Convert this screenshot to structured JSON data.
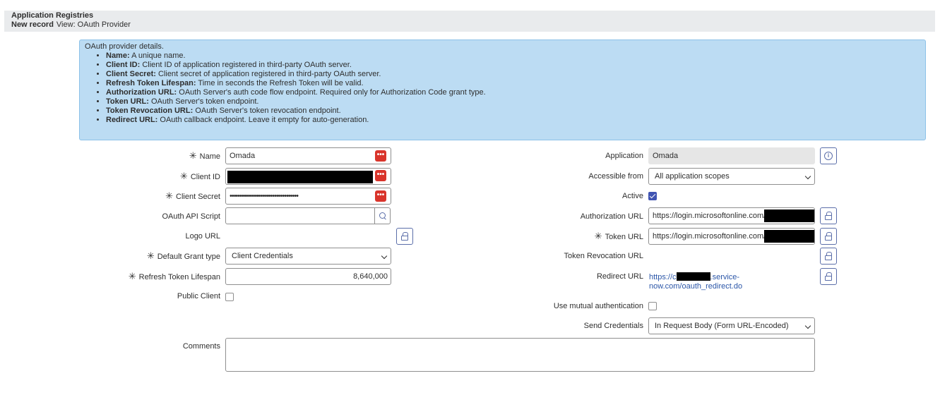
{
  "header": {
    "table_name": "Application Registries",
    "record_state": "New record",
    "view": "View: OAuth Provider"
  },
  "info": {
    "intro": "OAuth provider details.",
    "items": [
      {
        "term": "Name:",
        "desc": "A unique name."
      },
      {
        "term": "Client ID:",
        "desc": "Client ID of application registered in third-party OAuth server."
      },
      {
        "term": "Client Secret:",
        "desc": "Client secret of application registered in third-party OAuth server."
      },
      {
        "term": "Refresh Token Lifespan:",
        "desc": "Time in seconds the Refresh Token will be valid."
      },
      {
        "term": "Authorization URL:",
        "desc": "OAuth Server's auth code flow endpoint. Required only for Authorization Code grant type."
      },
      {
        "term": "Token URL:",
        "desc": "OAuth Server's token endpoint."
      },
      {
        "term": "Token Revocation URL:",
        "desc": "OAuth Server's token revocation endpoint."
      },
      {
        "term": "Redirect URL:",
        "desc": "OAuth callback endpoint. Leave it empty for auto-generation."
      }
    ]
  },
  "form": {
    "required_marker": "✳",
    "name": {
      "label": "Name",
      "value": "Omada"
    },
    "client_id": {
      "label": "Client ID"
    },
    "client_secret": {
      "label": "Client Secret",
      "value": "••••••••••••••••••••••••••••••••••"
    },
    "api_script": {
      "label": "OAuth API Script",
      "value": ""
    },
    "logo_url": {
      "label": "Logo URL"
    },
    "grant_type": {
      "label": "Default Grant type",
      "value": "Client Credentials"
    },
    "refresh_lifespan": {
      "label": "Refresh Token Lifespan",
      "value": "8,640,000"
    },
    "public_client": {
      "label": "Public Client",
      "checked": false
    },
    "comments": {
      "label": "Comments",
      "value": ""
    },
    "application": {
      "label": "Application",
      "value": "Omada"
    },
    "accessible_from": {
      "label": "Accessible from",
      "value": "All application scopes"
    },
    "active": {
      "label": "Active",
      "checked": true
    },
    "auth_url": {
      "label": "Authorization URL",
      "value": "https://login.microsoftonline.com/4"
    },
    "token_url": {
      "label": "Token URL",
      "value": "https://login.microsoftonline.com/4"
    },
    "revocation_url": {
      "label": "Token Revocation URL"
    },
    "redirect_url": {
      "label": "Redirect URL",
      "line1_prefix": "https://c",
      "line1_suffix": ".service-",
      "line2": "now.com/oauth_redirect.do"
    },
    "mutual_auth": {
      "label": "Use mutual authentication",
      "checked": false
    },
    "send_credentials": {
      "label": "Send Credentials",
      "value": "In Request Body (Form URL-Encoded)"
    }
  },
  "icons": {
    "more": "•••",
    "info": "i"
  },
  "colors": {
    "info_bg": "#bcdcf3",
    "required_red": "#d9342b",
    "accent": "#4054b2"
  }
}
